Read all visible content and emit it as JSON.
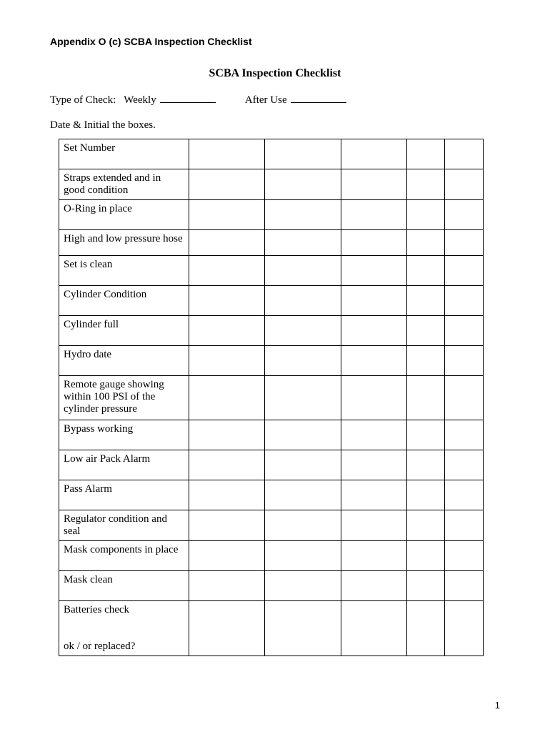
{
  "header": "Appendix O (c) SCBA Inspection Checklist",
  "title": "SCBA Inspection Checklist",
  "typeLine": {
    "prefix": "Type of Check:",
    "weekly": "Weekly",
    "afterUse": "After Use"
  },
  "instruction": "Date & Initial the boxes.",
  "rows": [
    "Set Number",
    "Straps extended and in good condition",
    "O-Ring in place",
    "High and low pressure hose",
    "Set is clean",
    "Cylinder Condition",
    "Cylinder full",
    "Hydro date",
    "Remote gauge showing within 100 PSI of the cylinder pressure",
    "Bypass working",
    "Low air Pack Alarm",
    "Pass Alarm",
    "Regulator condition and seal",
    "Mask components in place",
    "Mask clean",
    "Batteries check\n\nok / or replaced?"
  ],
  "pageNumber": "1"
}
